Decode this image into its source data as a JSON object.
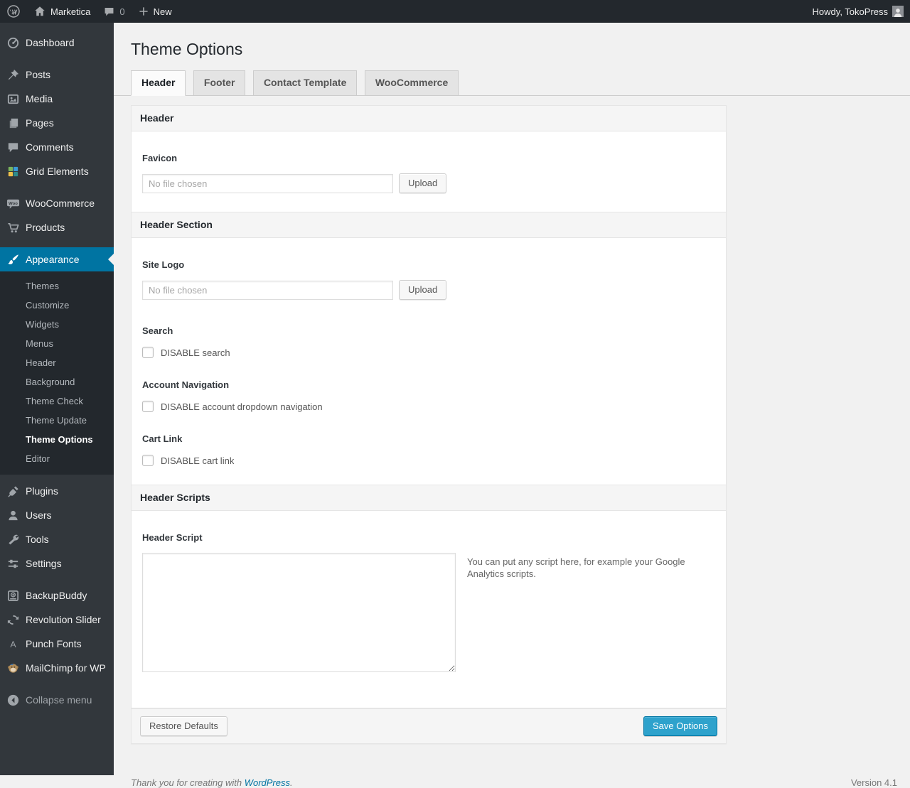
{
  "admin_bar": {
    "site_name": "Marketica",
    "comment_count": "0",
    "new_label": "New",
    "howdy": "Howdy, TokoPress"
  },
  "sidebar": {
    "menu_top": [
      {
        "label": "Dashboard",
        "icon": "dashboard-icon"
      },
      {
        "label": "Posts",
        "icon": "pin-icon"
      },
      {
        "label": "Media",
        "icon": "media-icon"
      },
      {
        "label": "Pages",
        "icon": "pages-icon"
      },
      {
        "label": "Comments",
        "icon": "comment-icon"
      },
      {
        "label": "Grid Elements",
        "icon": "grid-elements-icon"
      },
      {
        "label": "WooCommerce",
        "icon": "woocommerce-icon"
      },
      {
        "label": "Products",
        "icon": "cart-icon"
      }
    ],
    "appearance": {
      "label": "Appearance",
      "icon": "brush-icon",
      "active": true
    },
    "submenu": [
      "Themes",
      "Customize",
      "Widgets",
      "Menus",
      "Header",
      "Background",
      "Theme Check",
      "Theme Update",
      "Theme Options",
      "Editor"
    ],
    "submenu_current": "Theme Options",
    "menu_bottom": [
      {
        "label": "Plugins",
        "icon": "plug-icon"
      },
      {
        "label": "Users",
        "icon": "user-icon"
      },
      {
        "label": "Tools",
        "icon": "wrench-icon"
      },
      {
        "label": "Settings",
        "icon": "sliders-icon"
      },
      {
        "label": "BackupBuddy",
        "icon": "backup-icon"
      },
      {
        "label": "Revolution Slider",
        "icon": "refresh-icon"
      },
      {
        "label": "Punch Fonts",
        "icon": "letter-a-icon"
      },
      {
        "label": "MailChimp for WP",
        "icon": "monkey-icon"
      }
    ],
    "collapse_label": "Collapse menu"
  },
  "page": {
    "title": "Theme Options",
    "tabs": [
      {
        "label": "Header",
        "active": true
      },
      {
        "label": "Footer",
        "active": false
      },
      {
        "label": "Contact Template",
        "active": false
      },
      {
        "label": "WooCommerce",
        "active": false
      }
    ]
  },
  "panel": {
    "header_section_title": "Header",
    "favicon": {
      "label": "Favicon",
      "file_placeholder": "No file chosen",
      "upload": "Upload"
    },
    "header_area_title": "Header Section",
    "site_logo": {
      "label": "Site Logo",
      "file_placeholder": "No file chosen",
      "upload": "Upload"
    },
    "search": {
      "label": "Search",
      "checkbox_label": "DISABLE search",
      "checked": false
    },
    "account": {
      "label": "Account Navigation",
      "checkbox_label": "DISABLE account dropdown navigation",
      "checked": false
    },
    "cart": {
      "label": "Cart Link",
      "checkbox_label": "DISABLE cart link",
      "checked": false
    },
    "scripts_section_title": "Header Scripts",
    "header_script": {
      "label": "Header Script",
      "value": "",
      "hint": "You can put any script here, for example your Google Analytics scripts."
    },
    "footer": {
      "restore": "Restore Defaults",
      "save": "Save Options"
    }
  },
  "page_footer": {
    "thanks_text": "Thank you for creating with ",
    "wordpress_link": "WordPress",
    "thanks_period": ".",
    "version": "Version 4.1"
  },
  "colors": {
    "admin_bar_bg": "#23282d",
    "menu_bg": "#32373c",
    "submenu_bg": "#23282d",
    "accent_blue": "#0074a2",
    "primary_button_bg": "#2ea2cc",
    "page_bg": "#f1f1f1",
    "panel_bg": "#ffffff"
  }
}
